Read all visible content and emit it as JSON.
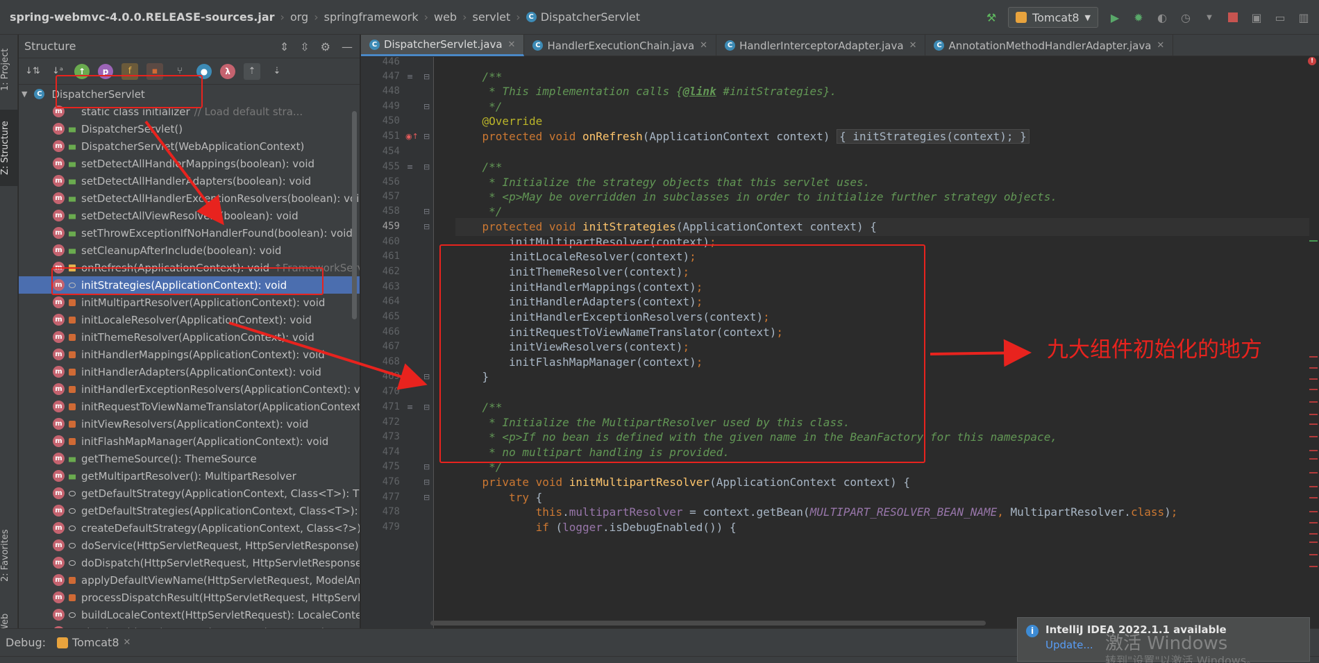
{
  "breadcrumbs": [
    "spring-webmvc-4.0.0.RELEASE-sources.jar",
    "org",
    "springframework",
    "web",
    "servlet",
    "DispatcherServlet"
  ],
  "toolbar": {
    "run_config": "Tomcat8"
  },
  "left_stripe": {
    "project_tab": "1: Project",
    "structure_tab": "Z: Structure",
    "favorites_tab": "2: Favorites",
    "web_tab": "Web"
  },
  "structure": {
    "title": "Structure",
    "root": "DispatcherServlet",
    "items": [
      {
        "label": "static class initializer",
        "suffix": "// Load default stra...",
        "vis": "static"
      },
      {
        "label": "DispatcherServlet()",
        "suffix": "",
        "vis": "public"
      },
      {
        "label": "DispatcherServlet(WebApplicationContext)",
        "suffix": "",
        "vis": "public"
      },
      {
        "label": "setDetectAllHandlerMappings(boolean): void",
        "suffix": "",
        "vis": "public"
      },
      {
        "label": "setDetectAllHandlerAdapters(boolean): void",
        "suffix": "",
        "vis": "public"
      },
      {
        "label": "setDetectAllHandlerExceptionResolvers(boolean): void",
        "suffix": "",
        "vis": "public"
      },
      {
        "label": "setDetectAllViewResolvers(boolean): void",
        "suffix": "",
        "vis": "public"
      },
      {
        "label": "setThrowExceptionIfNoHandlerFound(boolean): void",
        "suffix": "",
        "vis": "public"
      },
      {
        "label": "setCleanupAfterInclude(boolean): void",
        "suffix": "",
        "vis": "public"
      },
      {
        "label": "onRefresh(ApplicationContext): void",
        "suffix": "↑FrameworkServle",
        "vis": "protected"
      },
      {
        "label": "initStrategies(ApplicationContext): void",
        "suffix": "",
        "vis": "package"
      },
      {
        "label": "initMultipartResolver(ApplicationContext): void",
        "suffix": "",
        "vis": "private"
      },
      {
        "label": "initLocaleResolver(ApplicationContext): void",
        "suffix": "",
        "vis": "private"
      },
      {
        "label": "initThemeResolver(ApplicationContext): void",
        "suffix": "",
        "vis": "private"
      },
      {
        "label": "initHandlerMappings(ApplicationContext): void",
        "suffix": "",
        "vis": "private"
      },
      {
        "label": "initHandlerAdapters(ApplicationContext): void",
        "suffix": "",
        "vis": "private"
      },
      {
        "label": "initHandlerExceptionResolvers(ApplicationContext): vo",
        "suffix": "",
        "vis": "private"
      },
      {
        "label": "initRequestToViewNameTranslator(ApplicationContext",
        "suffix": "",
        "vis": "private"
      },
      {
        "label": "initViewResolvers(ApplicationContext): void",
        "suffix": "",
        "vis": "private"
      },
      {
        "label": "initFlashMapManager(ApplicationContext): void",
        "suffix": "",
        "vis": "private"
      },
      {
        "label": "getThemeSource(): ThemeSource",
        "suffix": "",
        "vis": "public"
      },
      {
        "label": "getMultipartResolver(): MultipartResolver",
        "suffix": "",
        "vis": "public"
      },
      {
        "label": "getDefaultStrategy(ApplicationContext, Class<T>): T",
        "suffix": "",
        "vis": "package"
      },
      {
        "label": "getDefaultStrategies(ApplicationContext, Class<T>): Li",
        "suffix": "",
        "vis": "package"
      },
      {
        "label": "createDefaultStrategy(ApplicationContext, Class<?>): C",
        "suffix": "",
        "vis": "package"
      },
      {
        "label": "doService(HttpServletRequest, HttpServletResponse):",
        "suffix": "",
        "vis": "package"
      },
      {
        "label": "doDispatch(HttpServletRequest, HttpServletResponse)",
        "suffix": "",
        "vis": "package"
      },
      {
        "label": "applyDefaultViewName(HttpServletRequest, ModelAnc",
        "suffix": "",
        "vis": "private"
      },
      {
        "label": "processDispatchResult(HttpServletRequest, HttpServle",
        "suffix": "",
        "vis": "private"
      },
      {
        "label": "buildLocaleContext(HttpServletRequest): LocaleContex",
        "suffix": "",
        "vis": "package"
      },
      {
        "label": "checkMultipart(HttpServletRequest): HttpServletReque",
        "suffix": "",
        "vis": "package"
      }
    ]
  },
  "editor_tabs": [
    {
      "label": "DispatcherServlet.java",
      "active": true
    },
    {
      "label": "HandlerExecutionChain.java",
      "active": false
    },
    {
      "label": "HandlerInterceptorAdapter.java",
      "active": false
    },
    {
      "label": "AnnotationMethodHandlerAdapter.java",
      "active": false
    }
  ],
  "code": {
    "line_numbers": [
      "446",
      "447",
      "448",
      "449",
      "450",
      "451",
      "454",
      "455",
      "456",
      "457",
      "458",
      "459",
      "460",
      "461",
      "462",
      "463",
      "464",
      "465",
      "466",
      "467",
      "468",
      "469",
      "470",
      "471",
      "472",
      "473",
      "474",
      "475",
      "476",
      "477",
      "478",
      "479"
    ],
    "current_line": "459"
  },
  "annotation": {
    "text": "九大组件初始化的地方",
    "color": "#e8231e"
  },
  "debug": {
    "label": "Debug:",
    "tab": "Tomcat8"
  },
  "notification": {
    "title": "IntelliJ IDEA 2022.1.1 available",
    "link": "Update..."
  },
  "watermark": {
    "line1": "激活 Windows",
    "line2": "转到\"设置\"以激活 Windows。"
  },
  "colors": {
    "selection": "#4b6eaf",
    "keyword": "#cc7832",
    "method_decl": "#ffc66d",
    "doc_comment": "#629755",
    "annotation_red": "#e8231e"
  }
}
